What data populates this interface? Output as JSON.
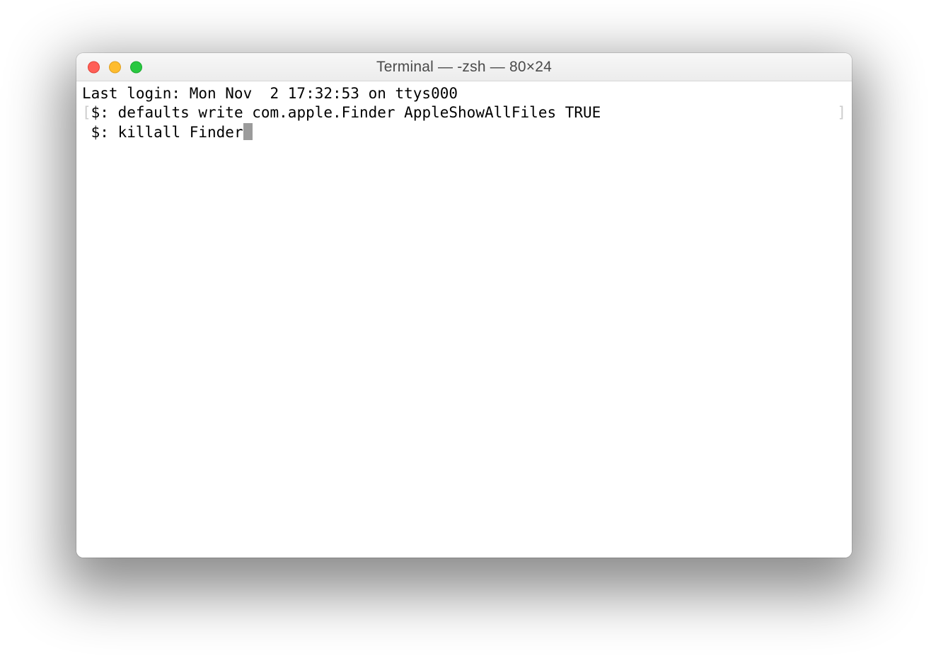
{
  "window": {
    "title": "Terminal — -zsh — 80×24"
  },
  "terminal": {
    "lines": [
      {
        "left_bracket": "",
        "content": "Last login: Mon Nov  2 17:32:53 on ttys000",
        "right_bracket": ""
      },
      {
        "left_bracket": "[",
        "prompt": "$: ",
        "content": "defaults write com.apple.Finder AppleShowAllFiles TRUE",
        "right_bracket": "]"
      },
      {
        "left_bracket": "",
        "prompt": "$: ",
        "content": "killall Finder",
        "cursor": true,
        "right_bracket": ""
      }
    ]
  }
}
